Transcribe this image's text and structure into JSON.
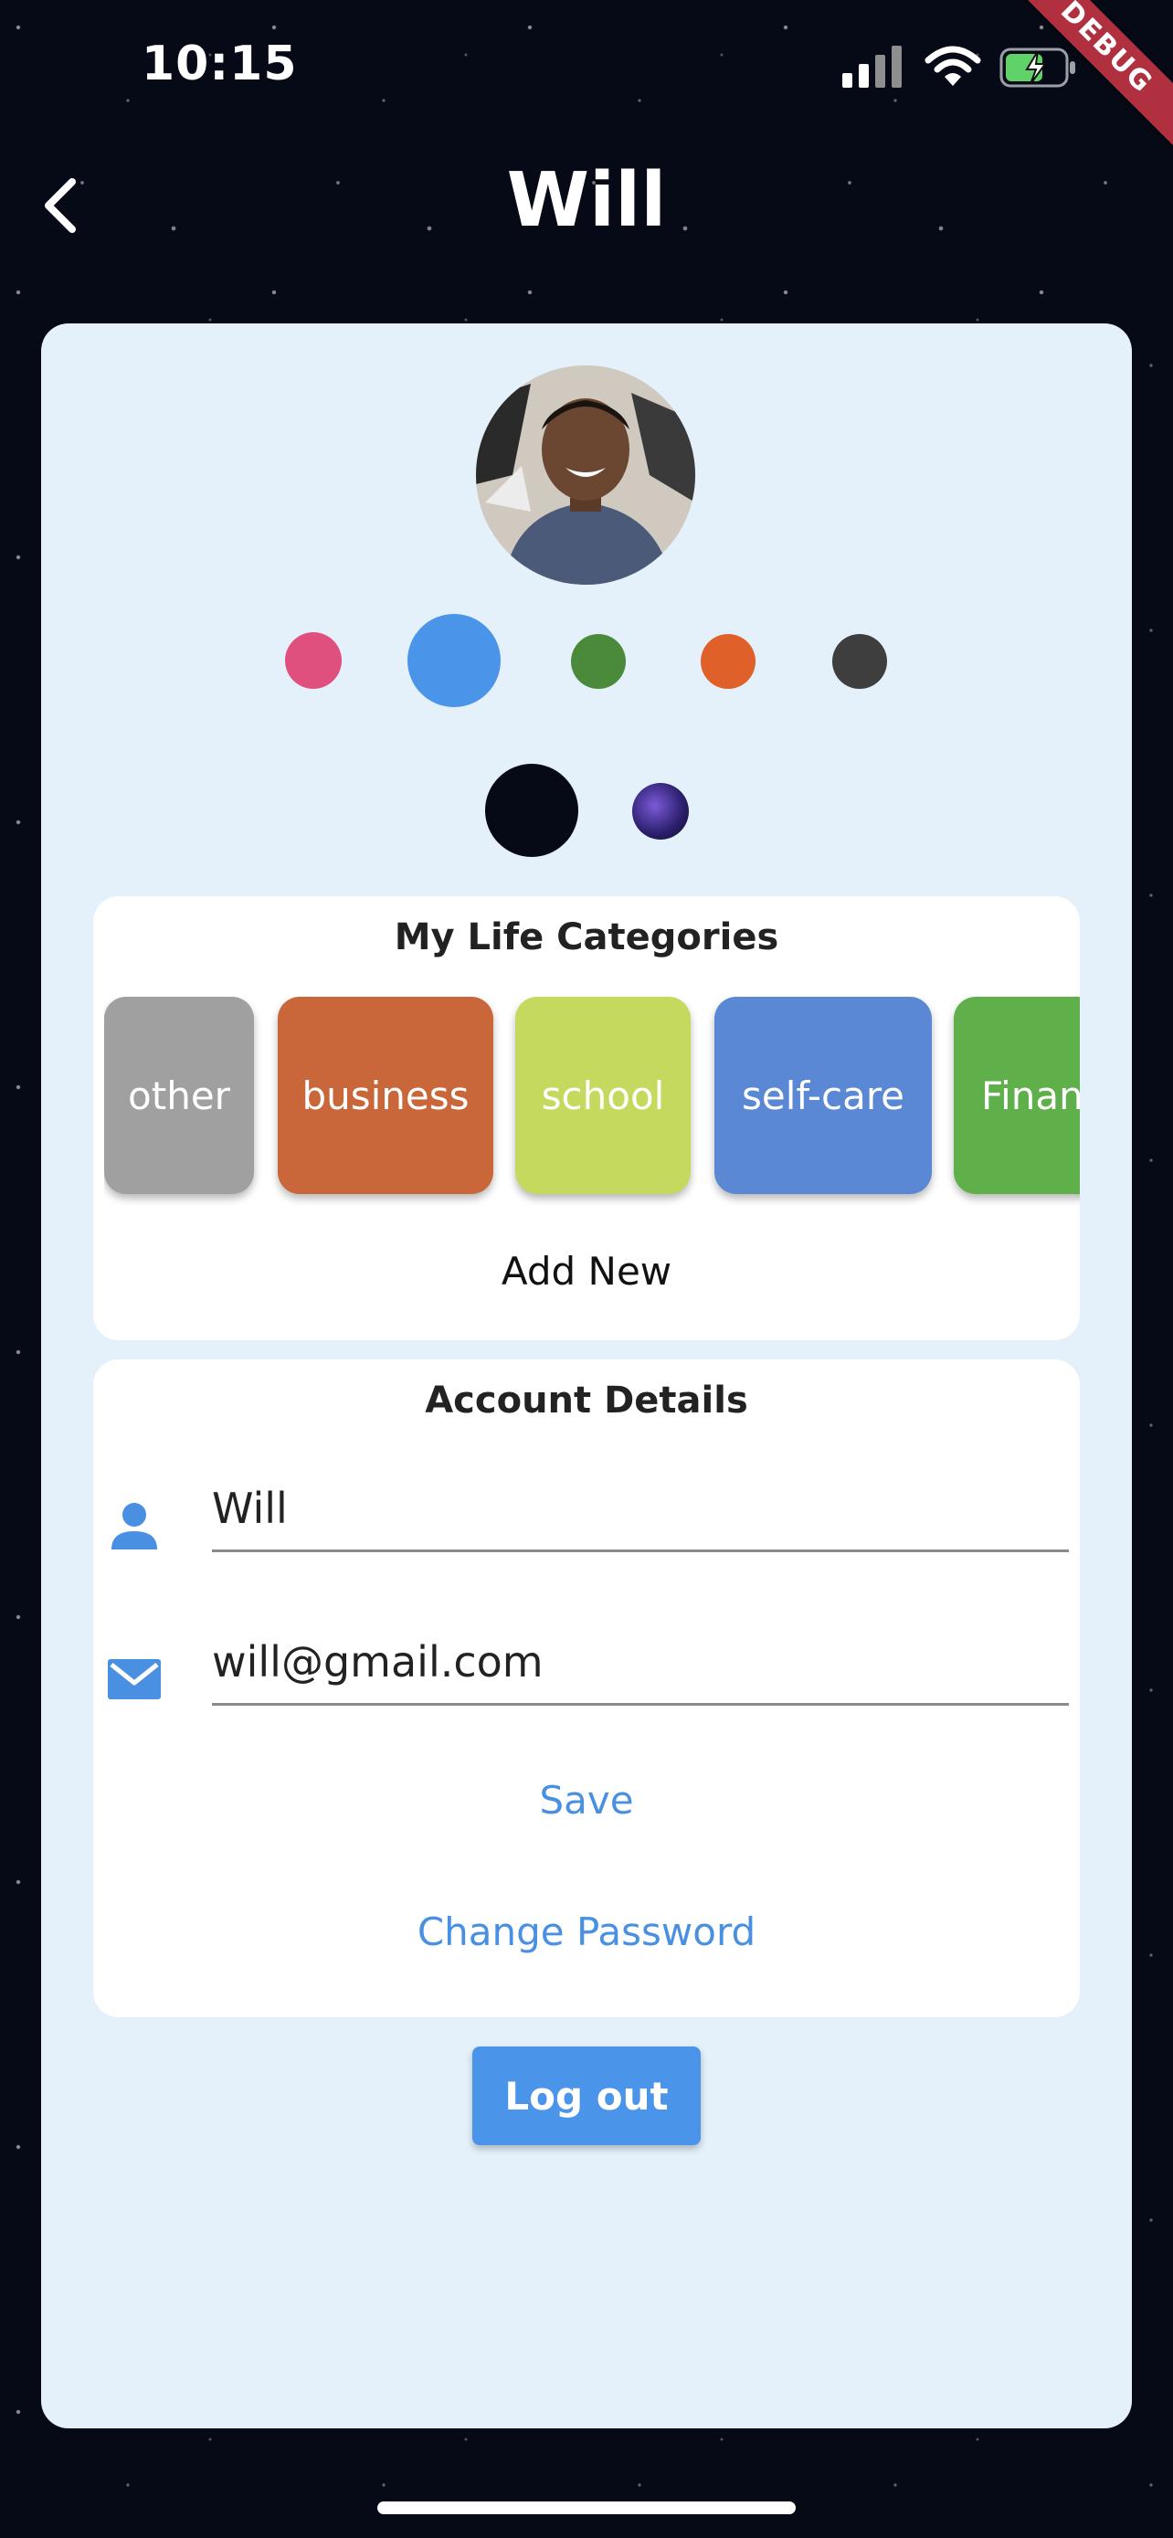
{
  "status_bar": {
    "time": "10:15",
    "debug_label": "DEBUG"
  },
  "nav": {
    "back_icon": "chevron-left-icon",
    "title": "Will"
  },
  "profile": {
    "avatar_icon": "avatar-photo",
    "color_swatches": [
      "#e0507e",
      "#4a95ea",
      "#4a8a3a",
      "#e0602a",
      "#3e3e3e"
    ],
    "selected_color": "#4a95ea",
    "background_options": [
      "dark-space",
      "purple-galaxy"
    ],
    "selected_background": "dark-space"
  },
  "categories": {
    "title": "My Life Categories",
    "items": [
      {
        "label": "other",
        "color": "#a0a0a0"
      },
      {
        "label": "business",
        "color": "#c9673a"
      },
      {
        "label": "school",
        "color": "#c5d95e"
      },
      {
        "label": "self-care",
        "color": "#5a88d4"
      },
      {
        "label": "Finance",
        "color": "#5fb04a"
      }
    ],
    "add_new_label": "Add New"
  },
  "account": {
    "title": "Account Details",
    "name_icon": "person-icon",
    "name_value": "Will",
    "email_icon": "mail-icon",
    "email_value": "will@gmail.com",
    "save_label": "Save",
    "change_password_label": "Change Password"
  },
  "logout_label": "Log out",
  "colors": {
    "accent": "#4a90e2",
    "card_bg": "#e4f1fb",
    "page_bg": "#060a16"
  }
}
